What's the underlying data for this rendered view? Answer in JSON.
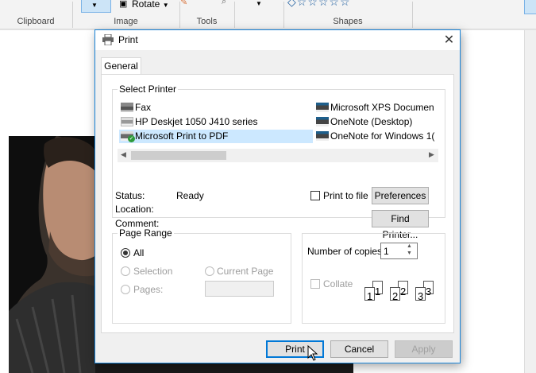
{
  "ribbon": {
    "groups": [
      "Clipboard",
      "Image",
      "Tools",
      "Shapes"
    ],
    "rotate_label": "Rotate"
  },
  "dialog": {
    "title": "Print",
    "close_glyph": "✕",
    "tab_general": "General",
    "select_printer_label": "Select Printer",
    "printers": [
      {
        "name": "Fax",
        "icon": "fax-printer-icon"
      },
      {
        "name": "HP Deskjet 1050 J410 series",
        "icon": "printer-icon"
      },
      {
        "name": "Microsoft Print to PDF",
        "icon": "default-printer-icon",
        "selected": true
      },
      {
        "name": "Microsoft XPS Documen",
        "icon": "printer-icon"
      },
      {
        "name": "OneNote (Desktop)",
        "icon": "printer-icon"
      },
      {
        "name": "OneNote for Windows 1(",
        "icon": "printer-icon"
      }
    ],
    "status_label": "Status:",
    "status_value": "Ready",
    "location_label": "Location:",
    "comment_label": "Comment:",
    "print_to_file_label": "Print to file",
    "preferences_label": "Preferences",
    "find_printer_label": "Find Printer...",
    "page_range_label": "Page Range",
    "range_all": "All",
    "range_selection": "Selection",
    "range_current_page": "Current Page",
    "range_pages": "Pages:",
    "copies_label": "Number of copies:",
    "copies_value": "1",
    "collate_label": "Collate",
    "collate_pages": [
      "1",
      "1",
      "2",
      "2",
      "3",
      "3"
    ],
    "print_button": "Print",
    "cancel_button": "Cancel",
    "apply_button": "Apply"
  },
  "colors": {
    "accent": "#0078d7",
    "selection": "#cce8ff"
  }
}
